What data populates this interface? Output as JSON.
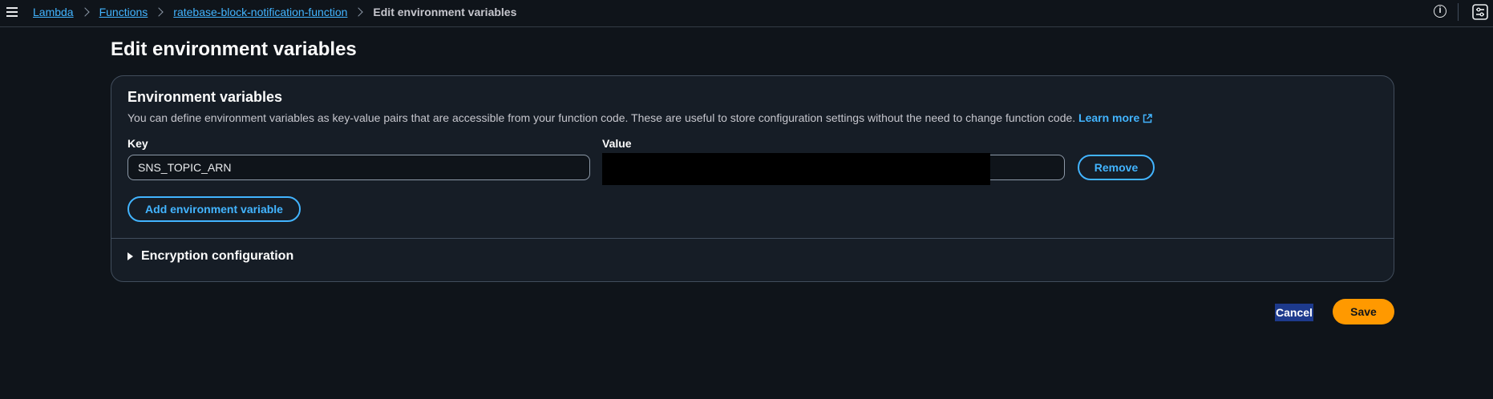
{
  "breadcrumb": {
    "items": [
      {
        "label": "Lambda"
      },
      {
        "label": "Functions"
      },
      {
        "label": "ratebase-block-notification-function"
      }
    ],
    "current": "Edit environment variables"
  },
  "page": {
    "title": "Edit environment variables"
  },
  "env_section": {
    "header": "Environment variables",
    "description": "You can define environment variables as key-value pairs that are accessible from your function code. These are useful to store configuration settings without the need to change function code.",
    "learn_more": "Learn more",
    "key_label": "Key",
    "value_label": "Value",
    "rows": [
      {
        "key": "SNS_TOPIC_ARN",
        "value": ""
      }
    ],
    "remove_label": "Remove",
    "add_label": "Add environment variable"
  },
  "encryption": {
    "label": "Encryption configuration"
  },
  "actions": {
    "cancel": "Cancel",
    "save": "Save"
  },
  "colors": {
    "background": "#0f141a",
    "container": "#161d26",
    "link": "#42b4ff",
    "primary": "#ff9900"
  }
}
